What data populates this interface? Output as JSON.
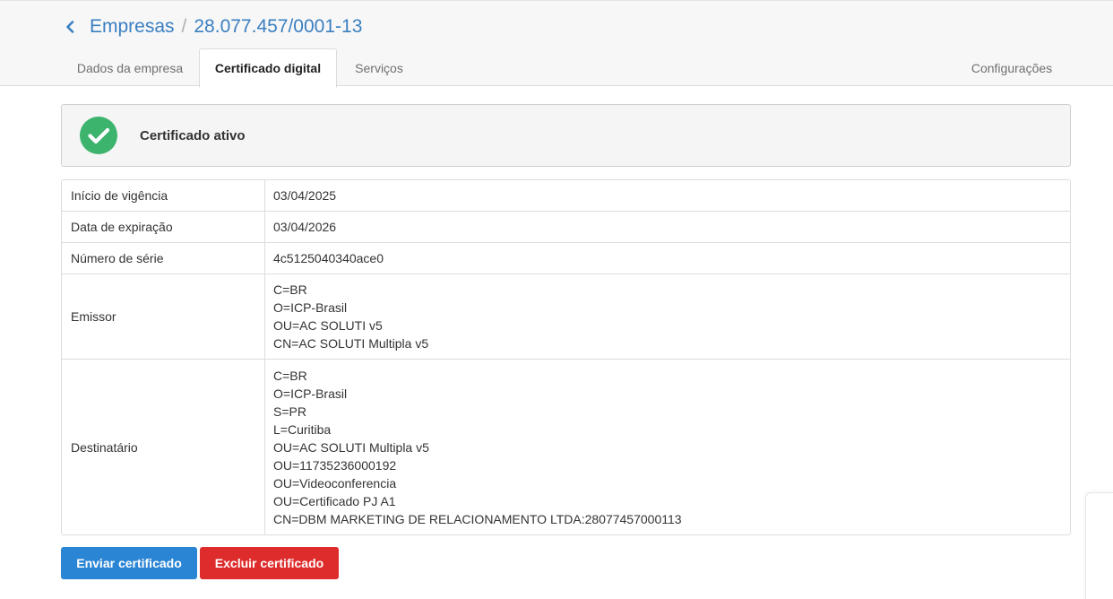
{
  "breadcrumb": {
    "parent": "Empresas",
    "separator": "/",
    "current": "28.077.457/0001-13"
  },
  "tabs": [
    {
      "label": "Dados da empresa",
      "active": false
    },
    {
      "label": "Certificado digital",
      "active": true
    },
    {
      "label": "Serviços",
      "active": false
    },
    {
      "label": "Configurações",
      "active": false
    }
  ],
  "status": {
    "text": "Certificado ativo",
    "icon": "check-circle-icon",
    "color": "#3db46d"
  },
  "details": {
    "inicio": {
      "label": "Início de vigência",
      "value": "03/04/2025"
    },
    "expiracao": {
      "label": "Data de expiração",
      "value": "03/04/2026"
    },
    "serie": {
      "label": "Número de série",
      "value": "4c5125040340ace0"
    },
    "emissor": {
      "label": "Emissor",
      "lines": [
        "C=BR",
        "O=ICP-Brasil",
        "OU=AC SOLUTI v5",
        "CN=AC SOLUTI Multipla v5"
      ]
    },
    "destinatario": {
      "label": "Destinatário",
      "lines": [
        "C=BR",
        "O=ICP-Brasil",
        "S=PR",
        "L=Curitiba",
        "OU=AC SOLUTI Multipla v5",
        "OU=11735236000192",
        "OU=Videoconferencia",
        "OU=Certificado PJ A1",
        "CN=DBM MARKETING DE RELACIONAMENTO LTDA:28077457000113"
      ]
    }
  },
  "actions": {
    "send_label": "Enviar certificado",
    "delete_label": "Excluir certificado"
  },
  "colors": {
    "link": "#3a7fc1",
    "primary": "#2a85d4",
    "danger": "#de2c2c",
    "success": "#3db46d"
  }
}
